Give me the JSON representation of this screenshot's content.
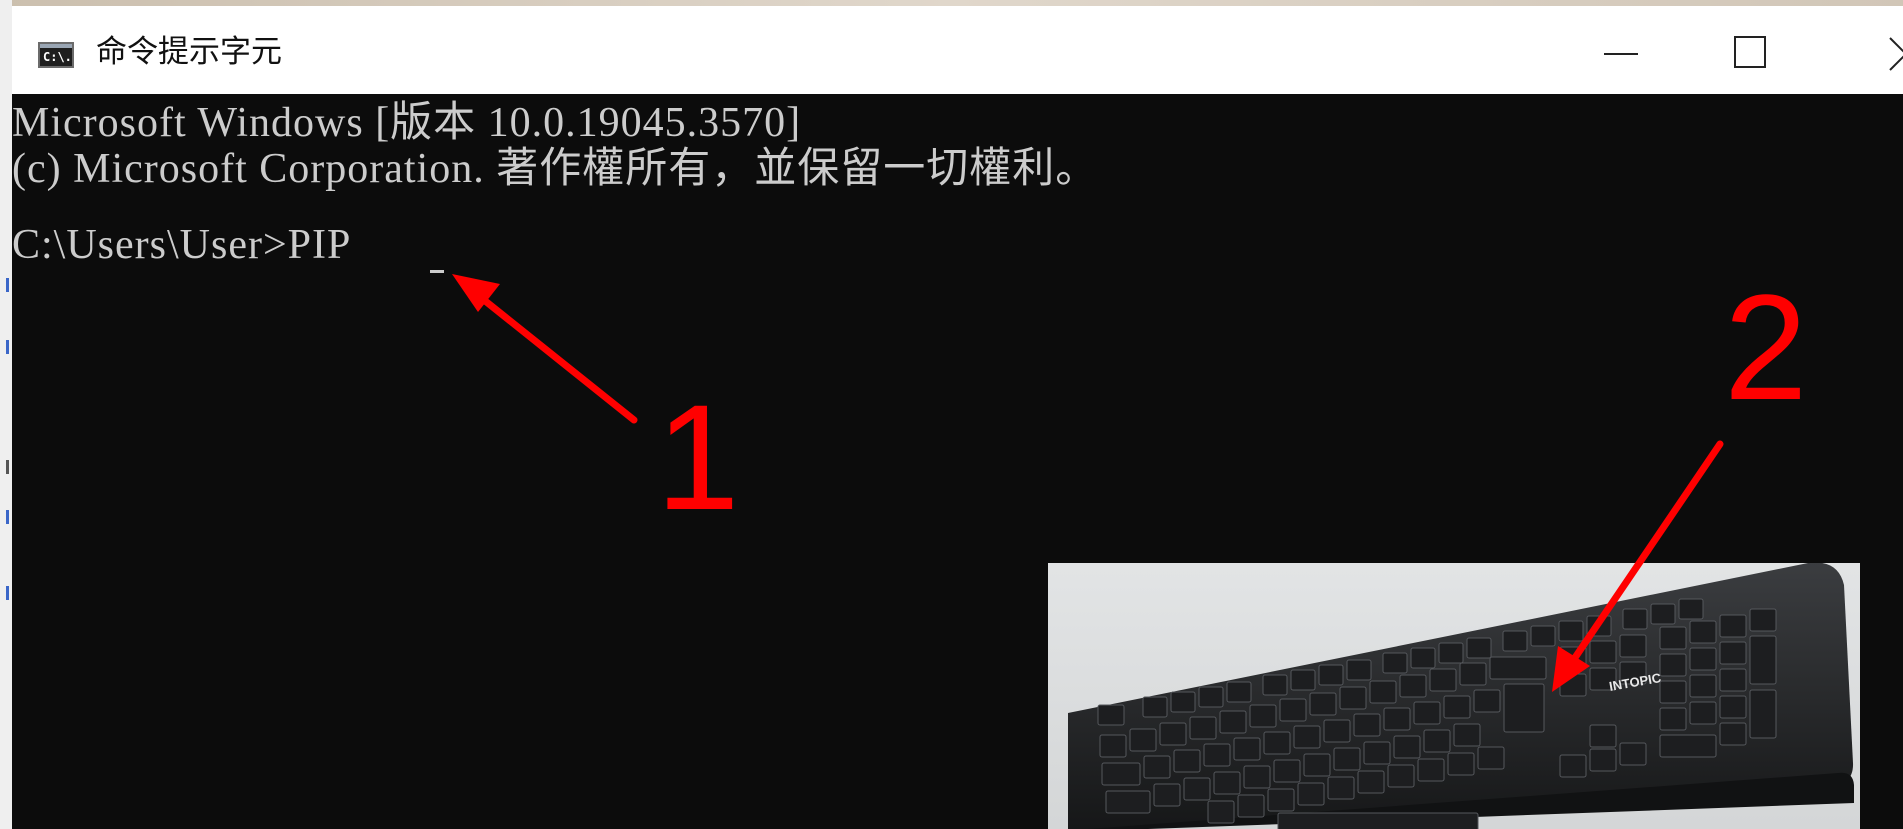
{
  "window": {
    "title": "命令提示字元",
    "icon": "console-app-icon",
    "icon_glyph": "C:\\.",
    "controls": [
      "minimize-icon",
      "maximize-icon",
      "close-icon"
    ]
  },
  "console": {
    "lines": [
      "Microsoft Windows [版本 10.0.19045.3570]",
      "(c) Microsoft Corporation. 著作權所有，並保留一切權利。",
      "C:\\Users\\User>PIP"
    ]
  },
  "annotations": {
    "label_1": "1",
    "label_2": "2",
    "arrow_color": "#ff0000"
  },
  "keyboard_photo": {
    "brand": "INTOPIC",
    "icon": "keyboard-photo"
  },
  "colors": {
    "console_bg": "#0c0c0c",
    "console_text": "#cccccc",
    "titlebar_bg": "#ffffff",
    "annotation": "#ff0000"
  }
}
